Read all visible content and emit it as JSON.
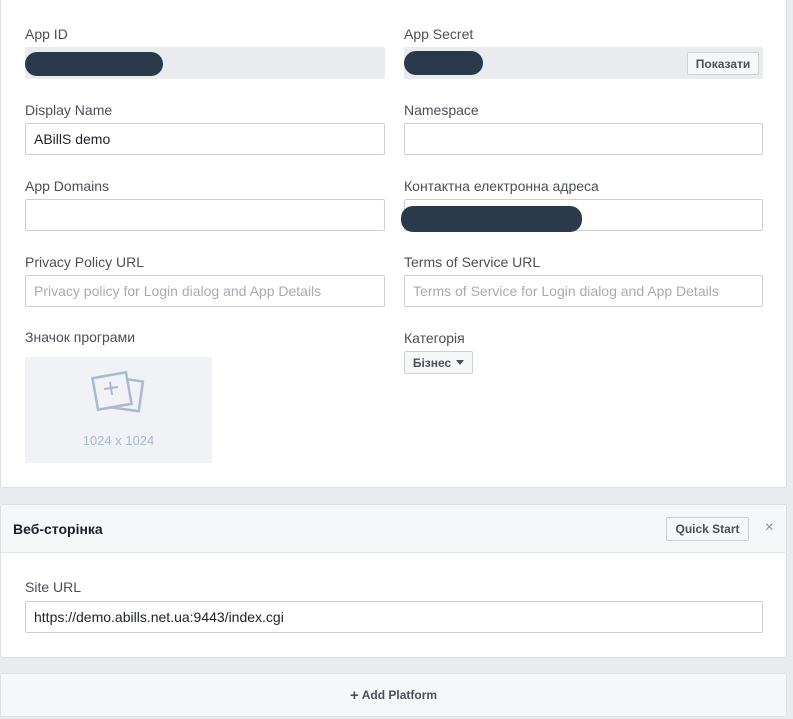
{
  "basic": {
    "app_id_label": "App ID",
    "app_secret_label": "App Secret",
    "show_button": "Показати",
    "display_name_label": "Display Name",
    "display_name_value": "ABillS demo",
    "namespace_label": "Namespace",
    "namespace_value": "",
    "app_domains_label": "App Domains",
    "app_domains_value": "",
    "contact_email_label": "Контактна електронна адреса",
    "privacy_label": "Privacy Policy URL",
    "privacy_placeholder": "Privacy policy for Login dialog and App Details",
    "terms_label": "Terms of Service URL",
    "terms_placeholder": "Terms of Service for Login dialog and App Details",
    "app_icon_label": "Значок програми",
    "app_icon_size": "1024 x 1024",
    "category_label": "Категорія",
    "category_value": "Бізнес"
  },
  "website": {
    "title": "Веб-сторінка",
    "quick_start": "Quick Start",
    "close": "×",
    "site_url_label": "Site URL",
    "site_url_value": "https://demo.abills.net.ua:9443/index.cgi"
  },
  "add_platform": {
    "icon": "+",
    "label": "Add Platform"
  }
}
